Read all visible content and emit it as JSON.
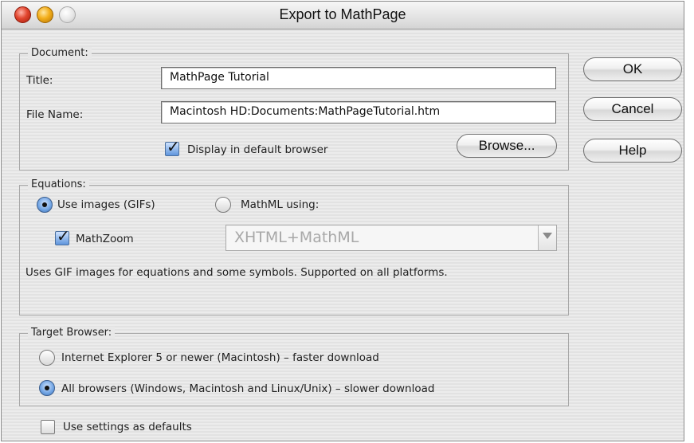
{
  "window": {
    "title": "Export to MathPage"
  },
  "document": {
    "legend": "Document:",
    "title_label": "Title:",
    "title_value": "MathPage Tutorial",
    "filename_label": "File Name:",
    "filename_value": "Macintosh HD:Documents:MathPageTutorial.htm",
    "display_checkbox_label": "Display in default browser",
    "display_checked": true,
    "browse_label": "Browse..."
  },
  "buttons": {
    "ok": "OK",
    "cancel": "Cancel",
    "help": "Help"
  },
  "equations": {
    "legend": "Equations:",
    "use_images_label": "Use images (GIFs)",
    "use_images_selected": true,
    "mathml_label": "MathML using:",
    "mathml_selected": false,
    "mathzoom_label": "MathZoom",
    "mathzoom_checked": true,
    "mathml_format_value": "XHTML+MathML",
    "description": "Uses GIF images for equations and some symbols. Supported on all platforms."
  },
  "target_browser": {
    "legend": "Target Browser:",
    "ie_label": "Internet Explorer 5 or newer (Macintosh) – faster download",
    "ie_selected": false,
    "all_label": "All browsers (Windows, Macintosh and Linux/Unix) – slower download",
    "all_selected": true
  },
  "defaults": {
    "label": "Use settings as defaults",
    "checked": false
  },
  "icons": {
    "check": "checkmark-icon",
    "dropdown": "chevron-down-icon"
  }
}
